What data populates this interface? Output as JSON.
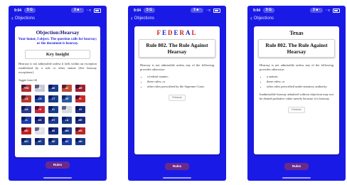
{
  "status": {
    "time": "9:04",
    "signal_pill": "5 G",
    "right_pill": "3 ■ ·",
    "icons": "· ≈"
  },
  "nav": {
    "back_label": "Objections"
  },
  "screen1": {
    "title": "Objection:Hearsay",
    "subtitle": "Your honor, I object. The question calls for hearsay; or the document is hearsay.",
    "key_insight": "Key Insight",
    "body": "Hearsay is not admissible unless it falls within an exception established by a rule or other statute (See hearsay exceptions).",
    "toggle_label": "Toggle Color Off",
    "flags": [
      {
        "code": "FED",
        "color": "#b03030"
      },
      {
        "code": "AL",
        "color": "#c8c8d8"
      },
      {
        "code": "AK",
        "color": "#1a3d8c"
      },
      {
        "code": "AZ",
        "color": "#c04a30"
      },
      {
        "code": "AR",
        "color": "#a02030"
      },
      {
        "code": "CA",
        "color": "#b83a2a"
      },
      {
        "code": "CO",
        "color": "#1a3ea0"
      },
      {
        "code": "CT",
        "color": "#1a3d8c"
      },
      {
        "code": "DE",
        "color": "#2a5aa0"
      },
      {
        "code": "FL",
        "color": "#c82828"
      },
      {
        "code": "GA",
        "color": "#2a3a8c"
      },
      {
        "code": "HI",
        "color": "#c82838"
      },
      {
        "code": "ID",
        "color": "#1a3d8c"
      },
      {
        "code": "IL",
        "color": "#d8d8e0"
      },
      {
        "code": "IN",
        "color": "#1a2a80"
      },
      {
        "code": "IA",
        "color": "#1a3da8"
      },
      {
        "code": "KS",
        "color": "#1a2a80"
      },
      {
        "code": "KY",
        "color": "#1a3a8c"
      },
      {
        "code": "LA",
        "color": "#1a3a8c"
      },
      {
        "code": "ME",
        "color": "#1a2a80"
      },
      {
        "code": "MD",
        "color": "#c02020"
      },
      {
        "code": "MA",
        "color": "#e0e0e8"
      },
      {
        "code": "MI",
        "color": "#1a2a80"
      },
      {
        "code": "MN",
        "color": "#1a3a8c"
      },
      {
        "code": "MS",
        "color": "#b82828"
      },
      {
        "code": "MO",
        "color": "#1a3a8c"
      },
      {
        "code": "MT",
        "color": "#1a3a8c"
      },
      {
        "code": "NE",
        "color": "#1a3a8c"
      },
      {
        "code": "NV",
        "color": "#1a3da8"
      },
      {
        "code": "NH",
        "color": "#1a3a8c"
      }
    ],
    "rules_button": "Rules"
  },
  "screen2": {
    "header": "FEDERAL",
    "rule_title": "Rule 802. The Rule Against Hearsay",
    "intro": "Hearsay is not admissible unless any of the following provides otherwise:",
    "items": [
      "a federal statute;",
      "these rules; or",
      "other rules prescribed by the Supreme Court."
    ],
    "previous_button": "Previous",
    "rules_button": "Rules"
  },
  "screen3": {
    "header": "Texas",
    "rule_title": "Rule 802. The Rule Against Hearsay",
    "intro": "Hearsay is not admissible unless any of the following provides otherwise:",
    "items": [
      "a statute;",
      "these rules; or",
      "other rules prescribed under statutory authority."
    ],
    "extra": "Inadmissible hearsay admitted without objection may not be denied probative value merely because it is hearsay.",
    "previous_button": "Previous",
    "rules_button": "Rules"
  }
}
